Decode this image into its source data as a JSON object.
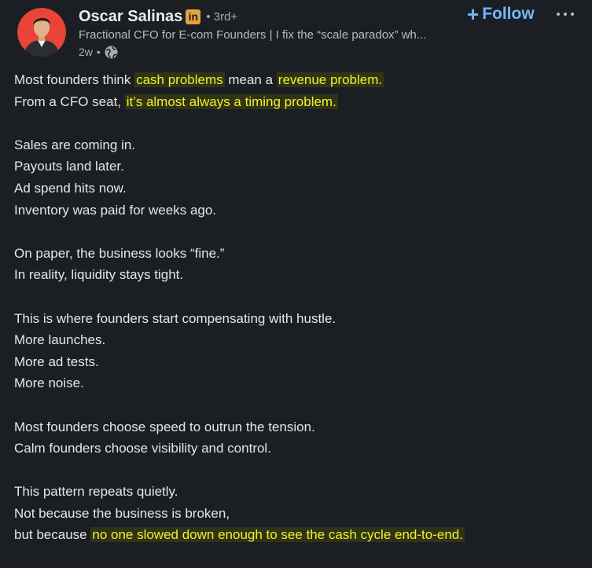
{
  "author": {
    "name": "Oscar Salinas",
    "badge": "in",
    "degree": "3rd+",
    "headline": "Fractional CFO for E-com Founders | I fix the “scale paradox” wh...",
    "time": "2w",
    "visibility_icon": "globe-icon"
  },
  "actions": {
    "follow_label": "Follow",
    "follow_icon": "plus-icon",
    "more_icon": "more-horizontal-icon"
  },
  "colors": {
    "background": "#1b1f23",
    "text": "#e6e6e6",
    "highlight_text": "#eef22e",
    "highlight_bg": "#2f3417",
    "follow": "#71b7fb",
    "linkedin_badge": "#e7a33e"
  },
  "post": {
    "p1": {
      "l1": {
        "a": "Most founders think ",
        "b": "cash problems",
        "c": " mean a ",
        "d": "revenue problem."
      },
      "l2": {
        "a": "From a CFO seat, ",
        "b": "it’s almost always a timing problem."
      }
    },
    "p2": [
      "Sales are coming in.",
      "Payouts land later.",
      "Ad spend hits now.",
      "Inventory was paid for weeks ago."
    ],
    "p3": [
      "On paper, the business looks “fine.”",
      "In reality, liquidity stays tight."
    ],
    "p4": [
      "This is where founders start compensating with hustle.",
      "More launches.",
      "More ad tests.",
      "More noise."
    ],
    "p5": [
      "Most founders choose speed to outrun the tension.",
      "Calm founders choose visibility and control."
    ],
    "p6": {
      "l1": "This pattern repeats quietly.",
      "l2": "Not because the business is broken,",
      "l3": {
        "a": "but because ",
        "b": "no one slowed down enough to see the cash cycle end-to-end."
      }
    }
  }
}
